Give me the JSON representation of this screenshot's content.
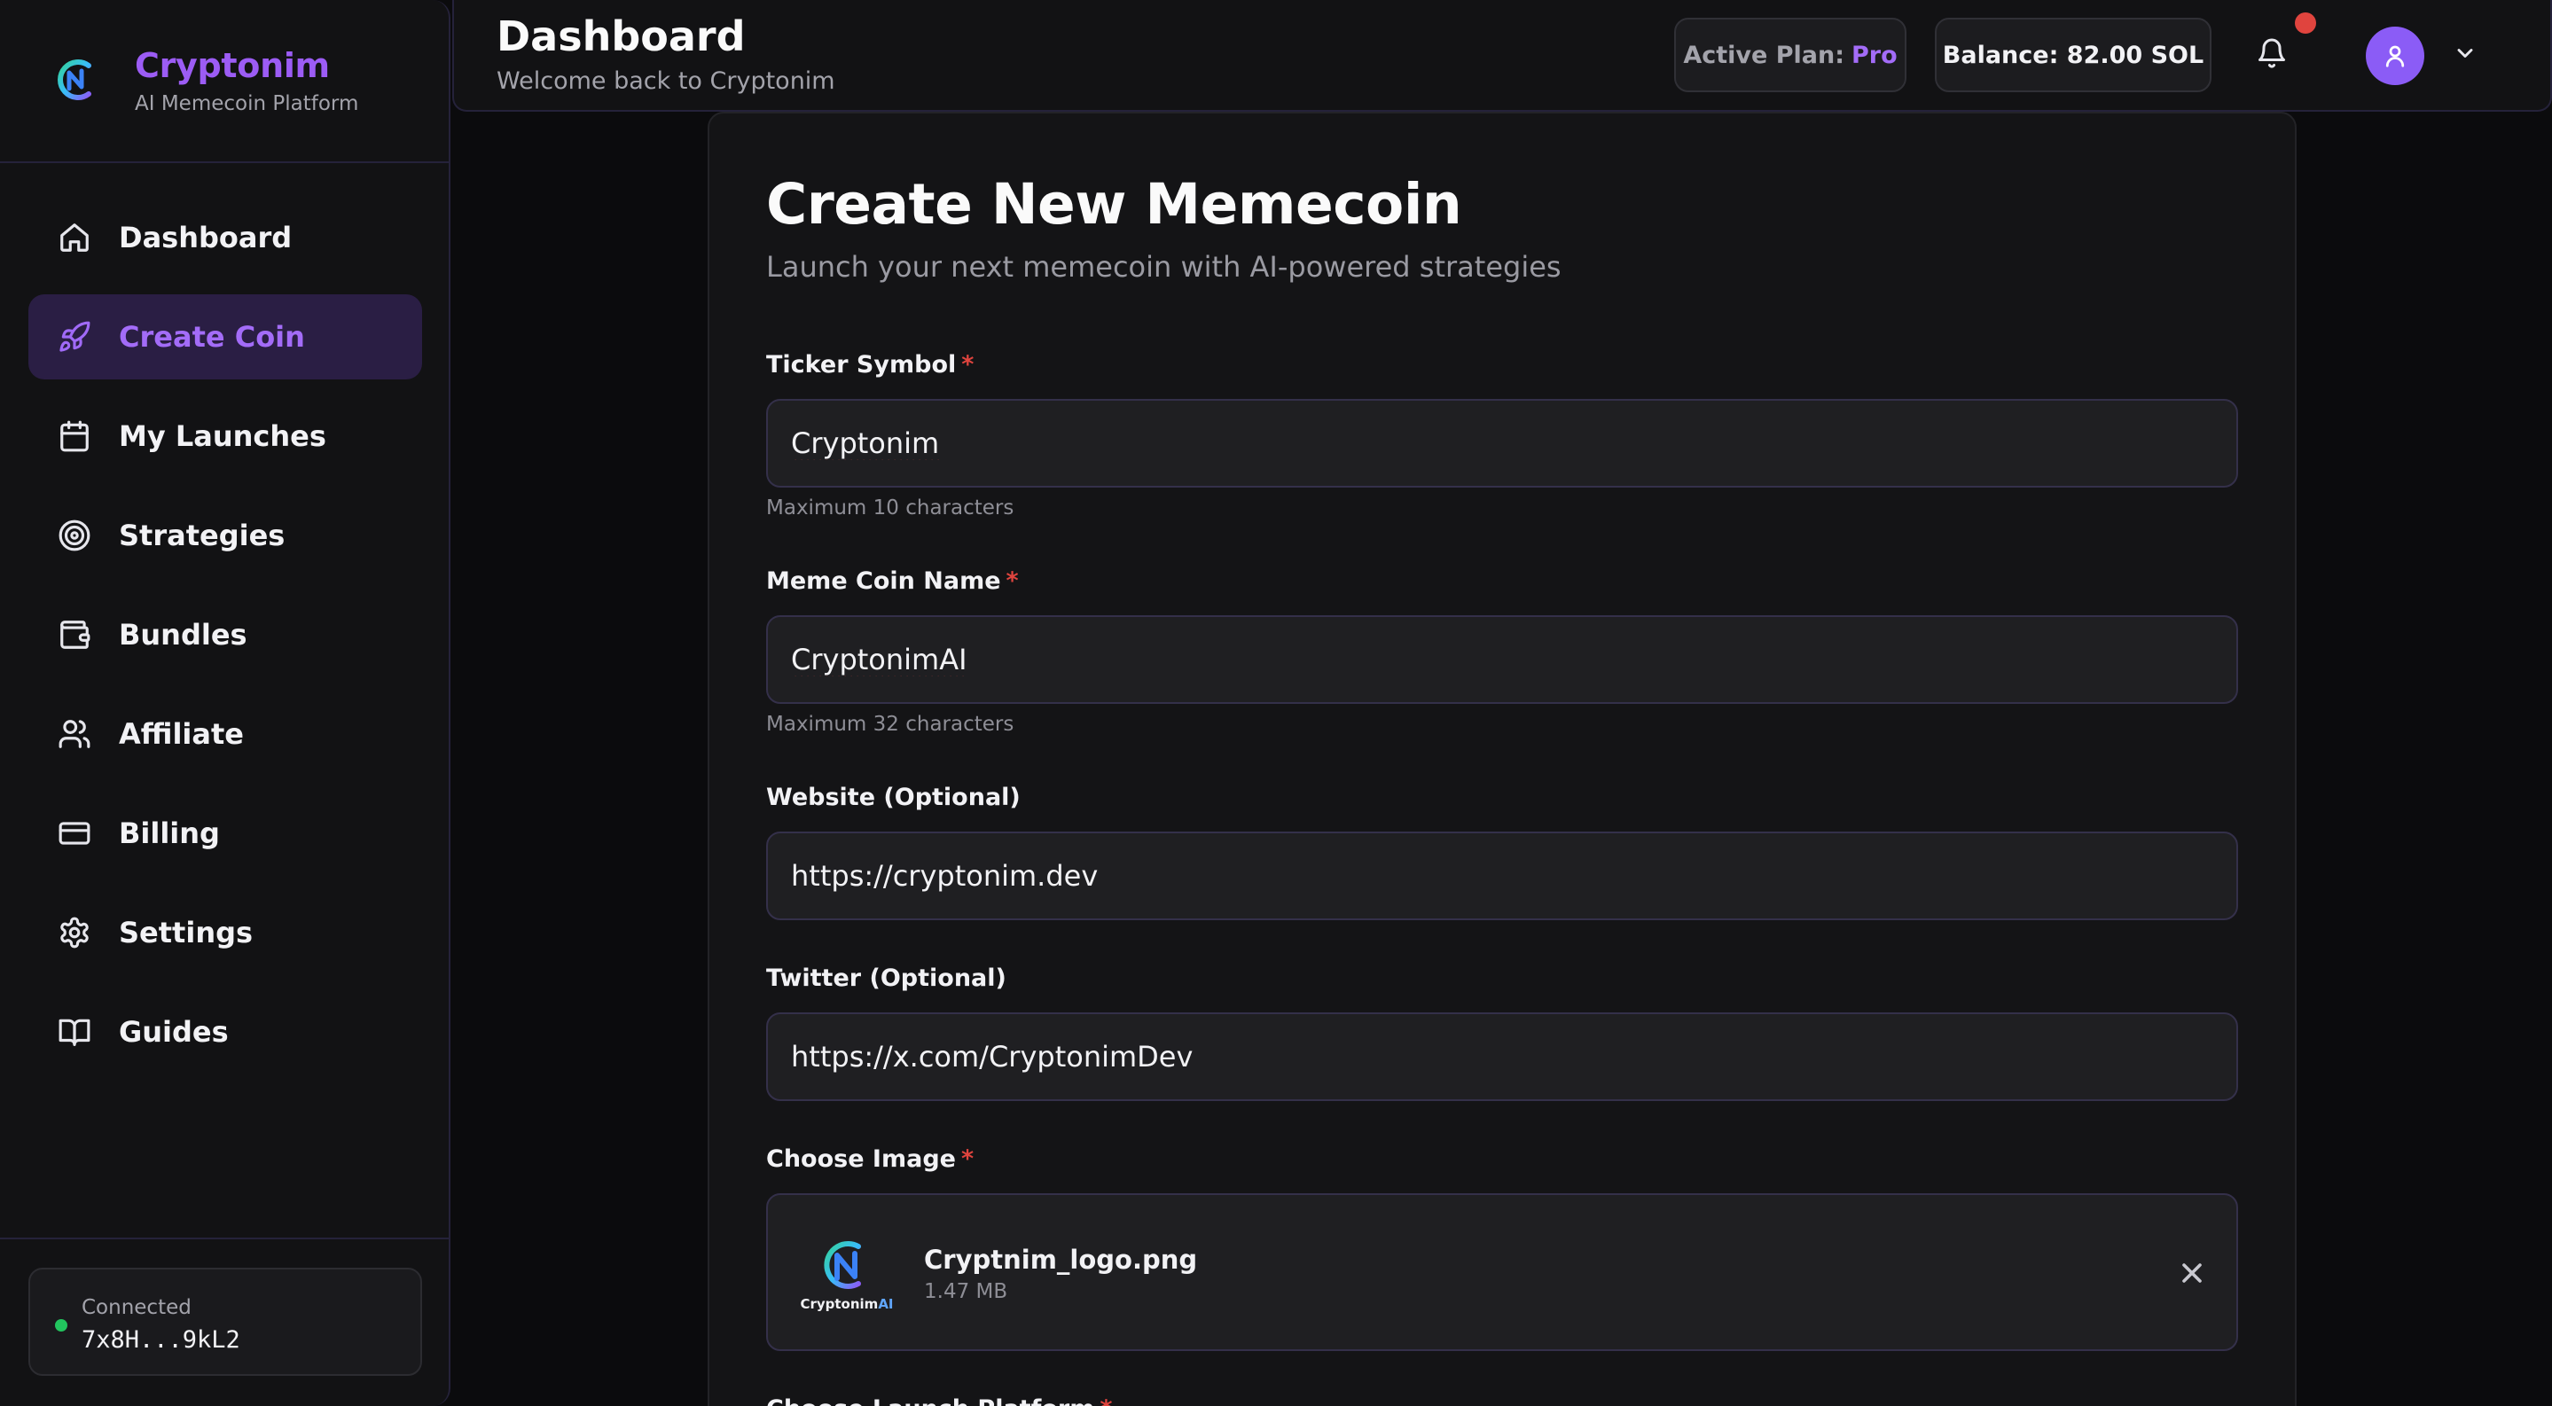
{
  "brand": {
    "name": "Cryptonim",
    "tagline": "AI Memecoin Platform"
  },
  "sidebar": {
    "items": [
      {
        "label": "Dashboard",
        "icon": "home-icon"
      },
      {
        "label": "Create Coin",
        "icon": "rocket-icon",
        "active": true
      },
      {
        "label": "My Launches",
        "icon": "calendar-icon"
      },
      {
        "label": "Strategies",
        "icon": "target-icon"
      },
      {
        "label": "Bundles",
        "icon": "wallet-icon"
      },
      {
        "label": "Affiliate",
        "icon": "users-icon"
      },
      {
        "label": "Billing",
        "icon": "credit-card-icon"
      },
      {
        "label": "Settings",
        "icon": "gear-icon"
      },
      {
        "label": "Guides",
        "icon": "book-open-icon"
      }
    ],
    "wallet": {
      "status": "Connected",
      "address": "7x8H...9kL2"
    }
  },
  "header": {
    "title": "Dashboard",
    "subtitle": "Welcome back to Cryptonim",
    "plan_label": "Active Plan:",
    "plan_value": "Pro",
    "balance": "Balance: 82.00 SOL"
  },
  "form": {
    "title": "Create New Memecoin",
    "subtitle": "Launch your next memecoin with AI-powered strategies",
    "ticker": {
      "label": "Ticker Symbol",
      "required": "*",
      "value": "Cryptonim",
      "hint": "Maximum 10 characters"
    },
    "name": {
      "label": "Meme Coin Name",
      "required": "*",
      "value": "CryptonimAI",
      "hint": "Maximum 32 characters"
    },
    "website": {
      "label": "Website (Optional)",
      "value": "https://cryptonim.dev"
    },
    "twitter": {
      "label": "Twitter (Optional)",
      "value": "https://x.com/CryptonimDev"
    },
    "image": {
      "label": "Choose Image",
      "required": "*",
      "file_name": "Cryptnim_logo.png",
      "file_size": "1.47 MB",
      "thumb_caption": "Cryptonim",
      "thumb_caption_ai": "AI"
    },
    "next_label": "Choose Launch Platform",
    "next_required": "*"
  },
  "colors": {
    "accent": "#9c5cf5",
    "active_bg": "#2a1e44",
    "danger": "#e0443e",
    "online": "#22c55e"
  }
}
